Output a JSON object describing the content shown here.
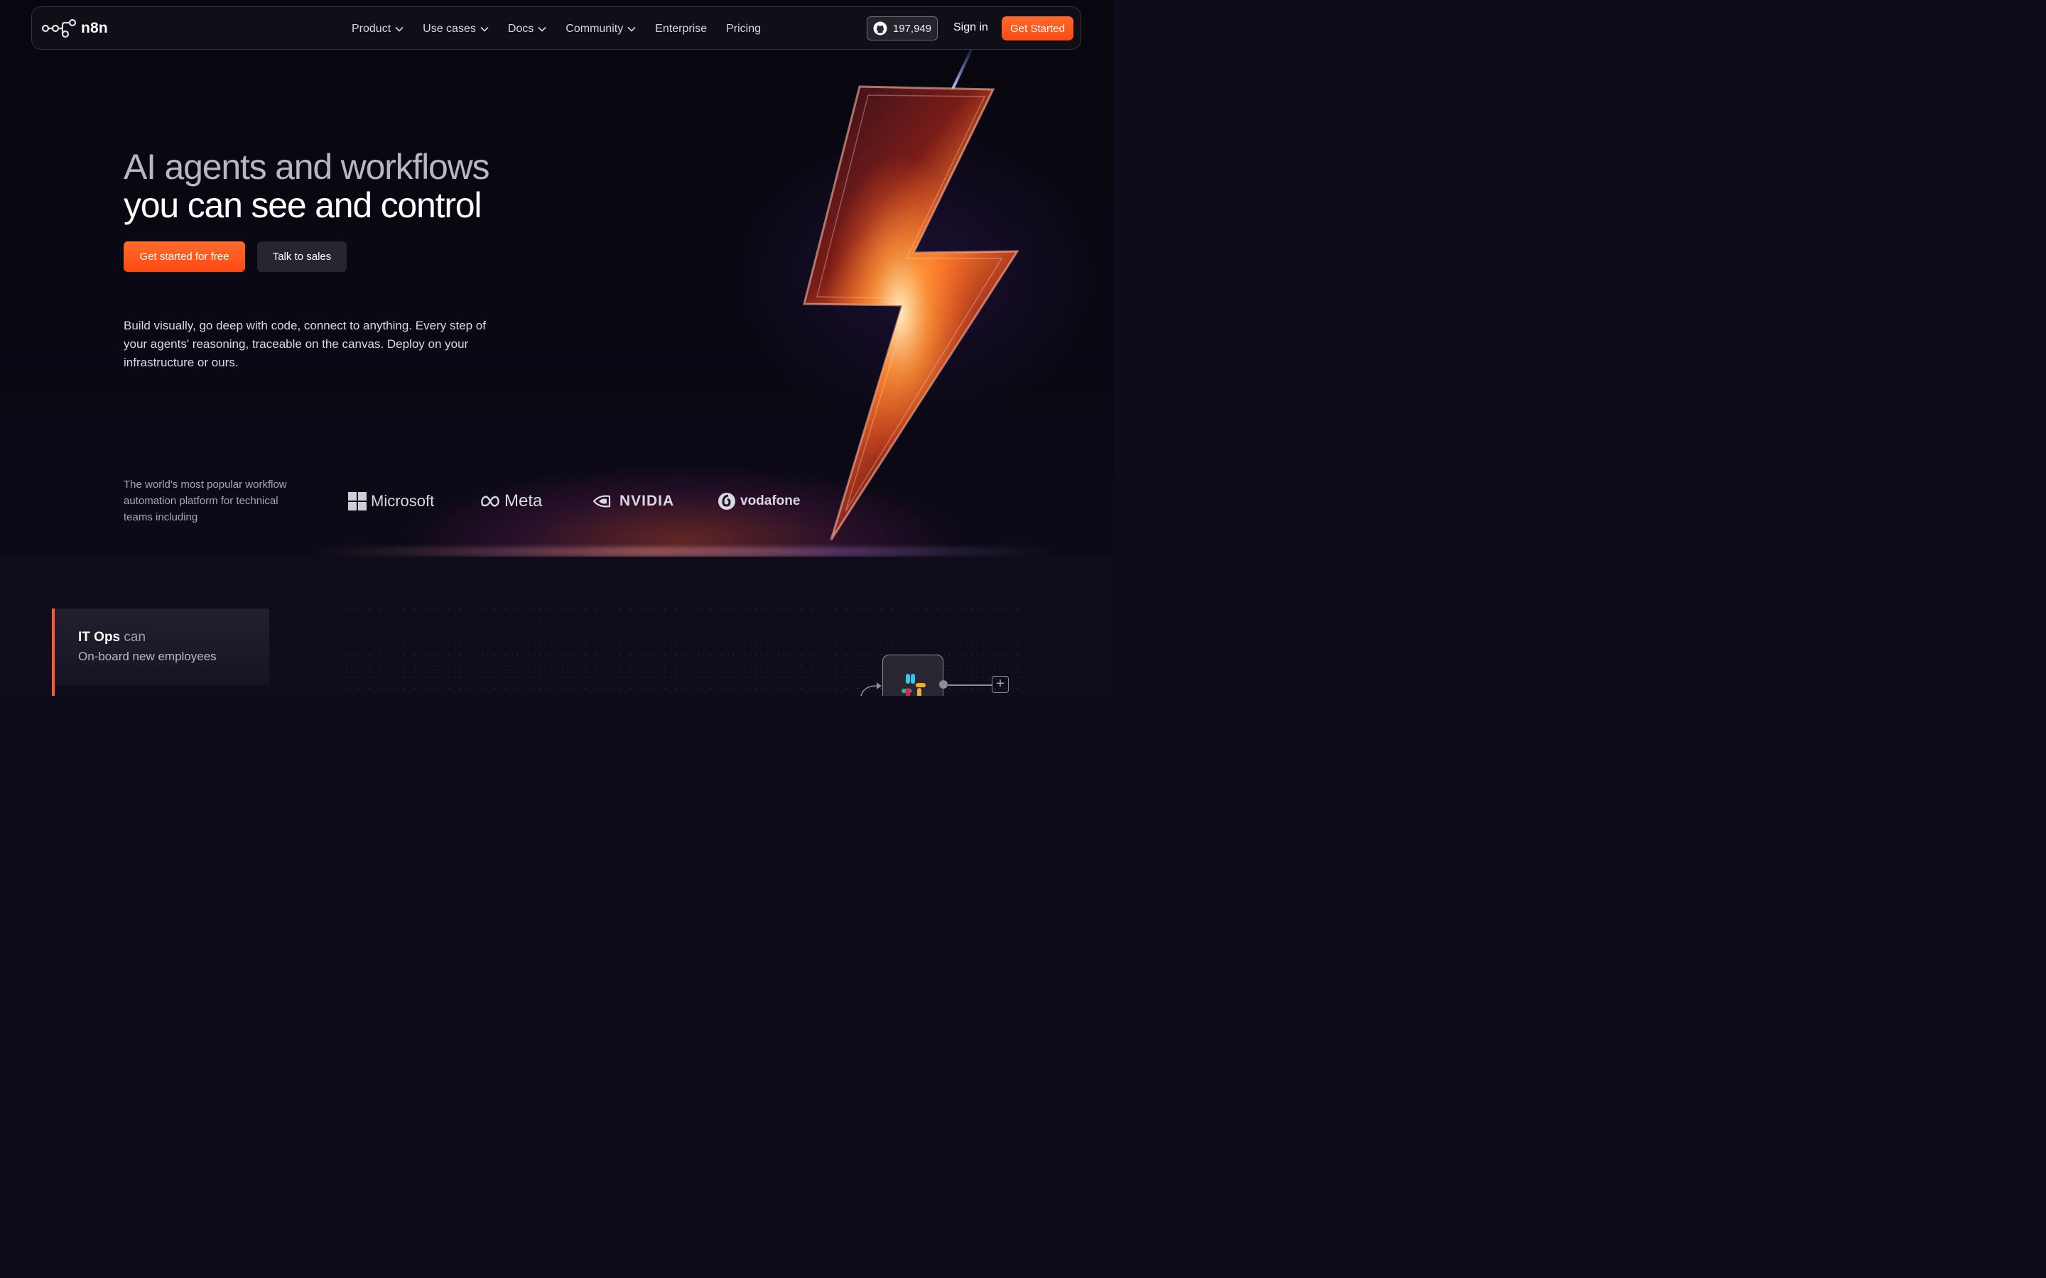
{
  "brand": {
    "name": "n8n",
    "accent": "#ff4f18"
  },
  "nav": {
    "links": [
      {
        "label": "Product",
        "dropdown": true
      },
      {
        "label": "Use cases",
        "dropdown": true
      },
      {
        "label": "Docs",
        "dropdown": true
      },
      {
        "label": "Community",
        "dropdown": true
      },
      {
        "label": "Enterprise",
        "dropdown": false
      },
      {
        "label": "Pricing",
        "dropdown": false
      }
    ],
    "github_stars": "197,949",
    "sign_in": "Sign in",
    "get_started": "Get Started"
  },
  "hero": {
    "title_line1": "AI agents and workflows",
    "title_line2": "you can see and control",
    "cta_primary": "Get started for free",
    "cta_secondary": "Talk to sales",
    "description": "Build visually, go deep with code, connect to anything. Every step of your agents' reasoning, traceable on the canvas. Deploy on your infrastructure or ours.",
    "trusted_text": "The world's most popular workflow automation platform for technical teams including",
    "logos": [
      "Microsoft",
      "Meta",
      "NVIDIA",
      "vodafone"
    ]
  },
  "use_case": {
    "role": "IT Ops",
    "verb": "can",
    "task": "On-board new employees"
  },
  "icons": [
    "n8n-logo-icon",
    "chevron-down-icon",
    "github-icon",
    "windows-logo-icon",
    "meta-logo-icon",
    "nvidia-logo-icon",
    "vodafone-logo-icon",
    "slack-icon",
    "plus-icon"
  ]
}
